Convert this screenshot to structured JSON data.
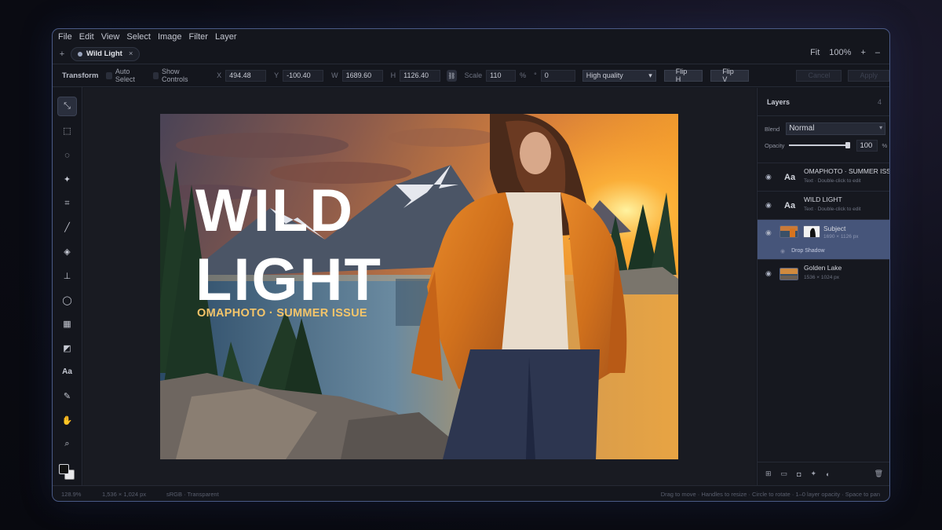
{
  "menu": [
    "File",
    "Edit",
    "View",
    "Select",
    "Image",
    "Filter",
    "Layer"
  ],
  "tabs": {
    "add": "+",
    "active_tab": "Wild Light",
    "close": "×",
    "fit": "Fit",
    "zoom": "100%",
    "zoom_in": "+",
    "zoom_out": "–"
  },
  "toolbar": {
    "title": "Transform",
    "auto_select": "Auto Select",
    "show_controls": "Show Controls",
    "x_label": "X",
    "x_value": "494.48",
    "y_label": "Y",
    "y_value": "-100.40",
    "w_label": "W",
    "w_value": "1689.60",
    "h_label": "H",
    "h_value": "1126.40",
    "link": "⛓",
    "scale_label": "Scale",
    "scale_value": "110",
    "scale_unit": "%",
    "rotate_label": "°",
    "rotate_value": "0",
    "quality": "High quality",
    "flip_h": "Flip H",
    "flip_v": "Flip V",
    "cancel": "Cancel",
    "apply": "Apply"
  },
  "tools": [
    "move-icon",
    "marquee-icon",
    "lasso-icon",
    "magic-wand-icon",
    "crop-icon",
    "brush-icon",
    "healing-icon",
    "stamp-icon",
    "blur-icon",
    "gradient-icon",
    "shape-icon",
    "type-icon",
    "eyedropper-icon",
    "hand-icon",
    "zoom-icon"
  ],
  "tool_glyphs": [
    "⤡",
    "⬚",
    "◌",
    "✦",
    "⌗",
    "╱",
    "◈",
    "⊥",
    "◯",
    "▦",
    "◩",
    "Aa",
    "✎",
    "✋",
    "⌕"
  ],
  "canvas": {
    "headline_1": "WILD",
    "headline_2": "LIGHT",
    "subtitle": "OMAPHOTO · SUMMER ISSUE"
  },
  "layers_panel": {
    "title": "Layers",
    "count": "4",
    "blend_label": "Blend",
    "blend_value": "Normal",
    "opacity_label": "Opacity",
    "opacity_value": "100",
    "opacity_unit": "%",
    "layers": [
      {
        "name": "OMAPHOTO · SUMMER ISSUE",
        "meta": "Text · Double-click to edit",
        "icon": "Aa"
      },
      {
        "name": "WILD LIGHT",
        "meta": "Text · Double-click to edit",
        "icon": "Aa"
      },
      {
        "name": "Subject",
        "meta": "1690 × 1126 px",
        "effect": "Drop Shadow"
      },
      {
        "name": "Golden Lake",
        "meta": "1536 × 1024 px"
      }
    ]
  },
  "status": {
    "zoom": "128.9%",
    "size": "1,536 × 1,024 px",
    "color": "sRGB · Transparent",
    "hint": "Drag to move · Handles to resize · Circle to rotate · 1–0 layer opacity · Space to pan"
  },
  "colors": {
    "accent": "#46557a",
    "subtitle": "#f4c56a",
    "border": "#4a5a86"
  }
}
